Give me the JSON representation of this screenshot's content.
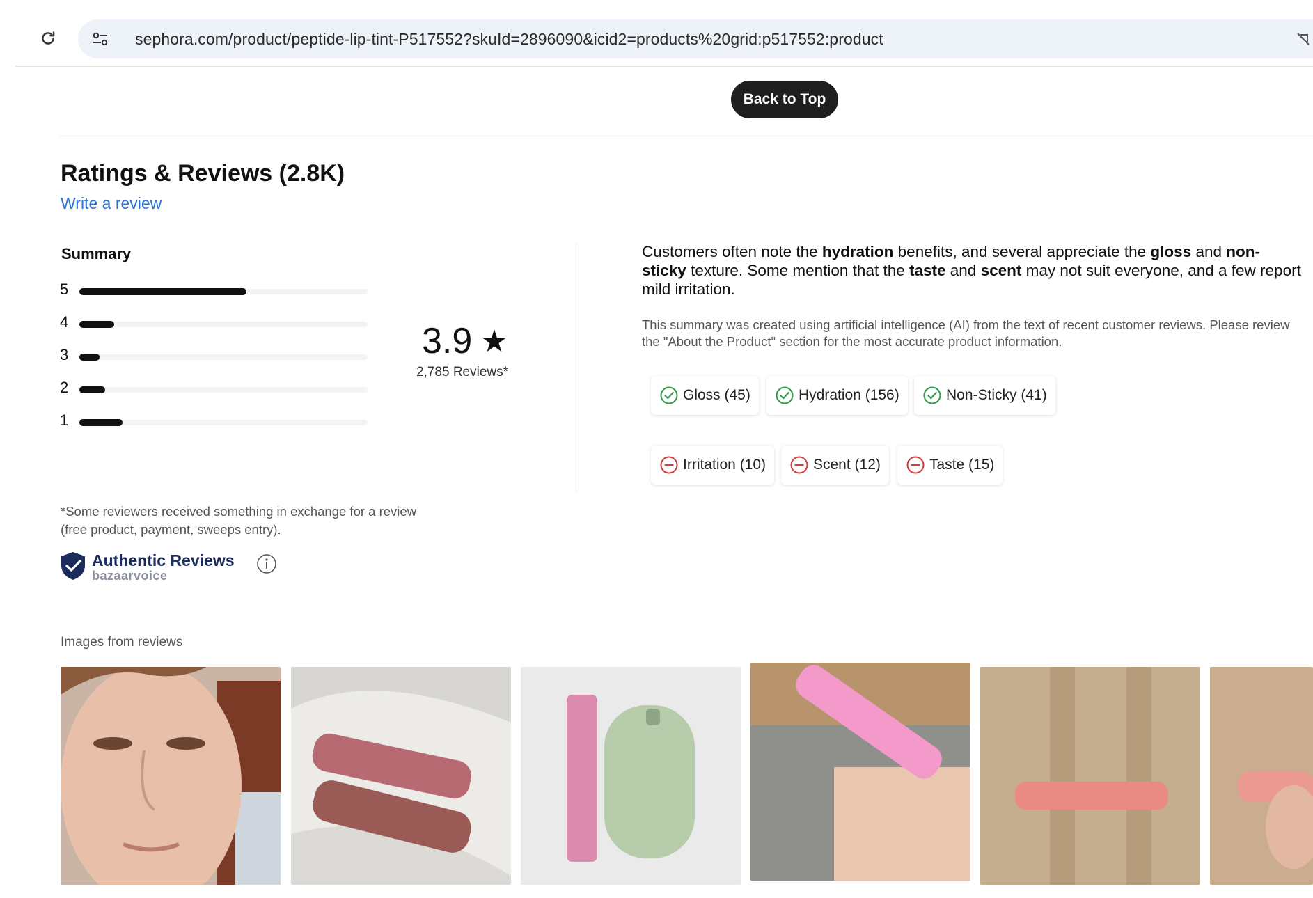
{
  "browser": {
    "url": "sephora.com/product/peptide-lip-tint-P517552?skuId=2896090&icid2=products%20grid:p517552:product",
    "reload_icon": "reload-icon",
    "site_info_icon": "tune-icon"
  },
  "back_to_top": "Back to Top",
  "reviews": {
    "title": "Ratings & Reviews (2.8K)",
    "write_review": "Write a review",
    "summary_label": "Summary",
    "distribution": [
      {
        "stars": "5",
        "fraction": 0.58
      },
      {
        "stars": "4",
        "fraction": 0.12
      },
      {
        "stars": "3",
        "fraction": 0.07
      },
      {
        "stars": "2",
        "fraction": 0.09
      },
      {
        "stars": "1",
        "fraction": 0.15
      }
    ],
    "average": "3.9",
    "star_glyph": "★",
    "count": "2,785 Reviews*",
    "ai_summary": {
      "p1": "Customers often note the ",
      "b1": "hydration",
      "p2": " benefits, and several appreciate the ",
      "b2": "gloss",
      "p3": " and ",
      "b3": "non-sticky",
      "p4": " texture. Some mention that the ",
      "b4": "taste",
      "p5": " and ",
      "b5": "scent",
      "p6": " may not suit everyone, and a few report mild irritation."
    },
    "ai_disclaimer": "This summary was created using artificial intelligence (AI) from the text of recent customer reviews. Please review the \"About the Product\" section for the most accurate product information.",
    "positive_tags": [
      {
        "label": "Gloss (45)"
      },
      {
        "label": "Hydration (156)"
      },
      {
        "label": "Non-Sticky (41)"
      }
    ],
    "negative_tags": [
      {
        "label": "Irritation (10)"
      },
      {
        "label": "Scent (12)"
      },
      {
        "label": "Taste (15)"
      }
    ],
    "incentive_note_line1": "*Some reviewers received something in exchange for a review",
    "incentive_note_line2": "(free product, payment, sweeps entry).",
    "badge_title": "Authentic Reviews",
    "badge_sub": "bazaarvoice",
    "images_label": "Images from reviews"
  },
  "colors": {
    "link": "#2c74d6",
    "positive": "#2f9a4a",
    "negative": "#d63a3a",
    "badge_navy": "#1a2b5c"
  }
}
